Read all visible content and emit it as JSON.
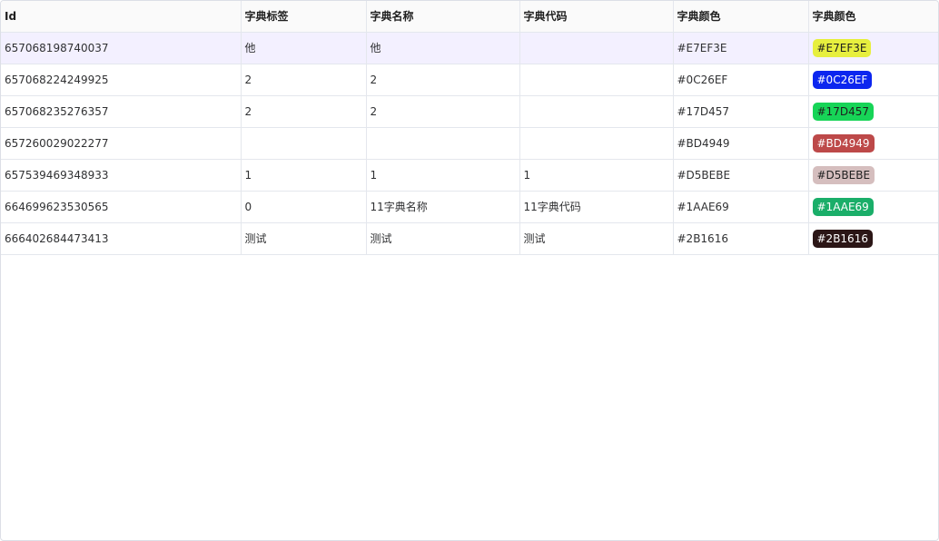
{
  "table": {
    "headers": [
      "Id",
      "字典标签",
      "字典名称",
      "字典代码",
      "字典颜色",
      "字典颜色"
    ],
    "rows": [
      {
        "id": "657068198740037",
        "label": "他",
        "name": "他",
        "code": "",
        "color_text": "#E7EF3E",
        "tag_text": "#E7EF3E",
        "tag_bg": "#E7EF3E",
        "tag_fg": "#1f1f1f"
      },
      {
        "id": "657068224249925",
        "label": "2",
        "name": "2",
        "code": "",
        "color_text": "#0C26EF",
        "tag_text": "#0C26EF",
        "tag_bg": "#0C26EF",
        "tag_fg": "#ffffff"
      },
      {
        "id": "657068235276357",
        "label": "2",
        "name": "2",
        "code": "",
        "color_text": "#17D457",
        "tag_text": "#17D457",
        "tag_bg": "#17D457",
        "tag_fg": "#1f1f1f"
      },
      {
        "id": "657260029022277",
        "label": "",
        "name": "",
        "code": "",
        "color_text": "#BD4949",
        "tag_text": "#BD4949",
        "tag_bg": "#BD4949",
        "tag_fg": "#ffffff"
      },
      {
        "id": "657539469348933",
        "label": "1",
        "name": "1",
        "code": "1",
        "color_text": "#D5BEBE",
        "tag_text": "#D5BEBE",
        "tag_bg": "#D5BEBE",
        "tag_fg": "#1f1f1f"
      },
      {
        "id": "664699623530565",
        "label": "0",
        "name": "11字典名称",
        "code": "11字典代码",
        "color_text": "#1AAE69",
        "tag_text": "#1AAE69",
        "tag_bg": "#1AAE69",
        "tag_fg": "#ffffff"
      },
      {
        "id": "666402684473413",
        "label": "测试",
        "name": "测试",
        "code": "测试",
        "color_text": "#2B1616",
        "tag_text": "#2B1616",
        "tag_bg": "#2B1616",
        "tag_fg": "#ffffff"
      }
    ],
    "highlight_row_bg": "#f3f0ff"
  }
}
